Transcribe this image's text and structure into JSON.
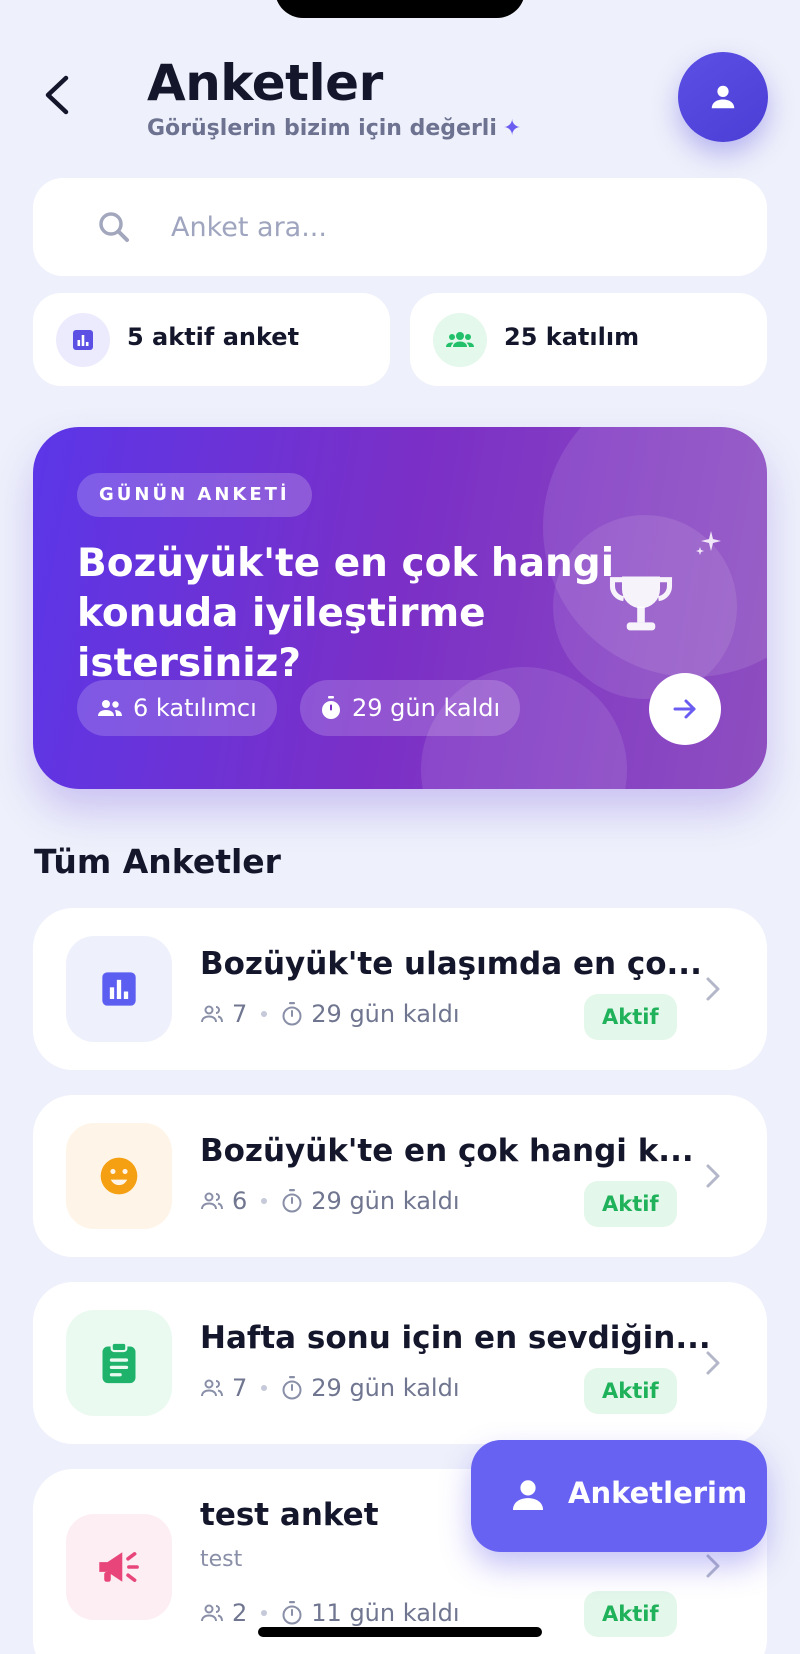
{
  "header": {
    "title": "Anketler",
    "subtitle": "Görüşlerin bizim için değerli",
    "subtitle_icon": "sparkle-icon"
  },
  "search": {
    "placeholder": "Anket ara...",
    "value": ""
  },
  "stats": [
    {
      "label": "5 aktif anket",
      "icon": "bar-chart-icon",
      "color": "#5b4fe4"
    },
    {
      "label": "25 katılım",
      "icon": "group-icon",
      "color": "#22c06a"
    }
  ],
  "featured": {
    "badge": "GÜNÜN ANKETİ",
    "question": "Bozüyük'te en çok hangi konuda iyileştirme istersiniz?",
    "participants": "6 katılımcı",
    "remaining": "29 gün kaldı",
    "icon": "trophy-icon"
  },
  "section_title": "Tüm Anketler",
  "surveys": [
    {
      "title": "Bozüyük'te ulaşımda en ço...",
      "participants": "7",
      "remaining": "29 gün kaldı",
      "status": "Aktif",
      "icon": "bar-chart-icon",
      "color": "#5b5ef0",
      "bg": "#eef0fb"
    },
    {
      "title": "Bozüyük'te en çok hangi k...",
      "participants": "6",
      "remaining": "29 gün kaldı",
      "status": "Aktif",
      "icon": "smile-icon",
      "color": "#f5a012",
      "bg": "#fff4e8"
    },
    {
      "title": "Hafta sonu için en sevdiğin...",
      "participants": "7",
      "remaining": "29 gün kaldı",
      "status": "Aktif",
      "icon": "clipboard-icon",
      "color": "#1fb26a",
      "bg": "#eafaf1"
    },
    {
      "title": "test anket",
      "description": "test",
      "participants": "2",
      "remaining": "11 gün kaldı",
      "status": "Aktif",
      "icon": "megaphone-icon",
      "color": "#e8467a",
      "bg": "#fdeef3"
    }
  ],
  "fab": {
    "label": "Anketlerim",
    "icon": "person-icon"
  }
}
